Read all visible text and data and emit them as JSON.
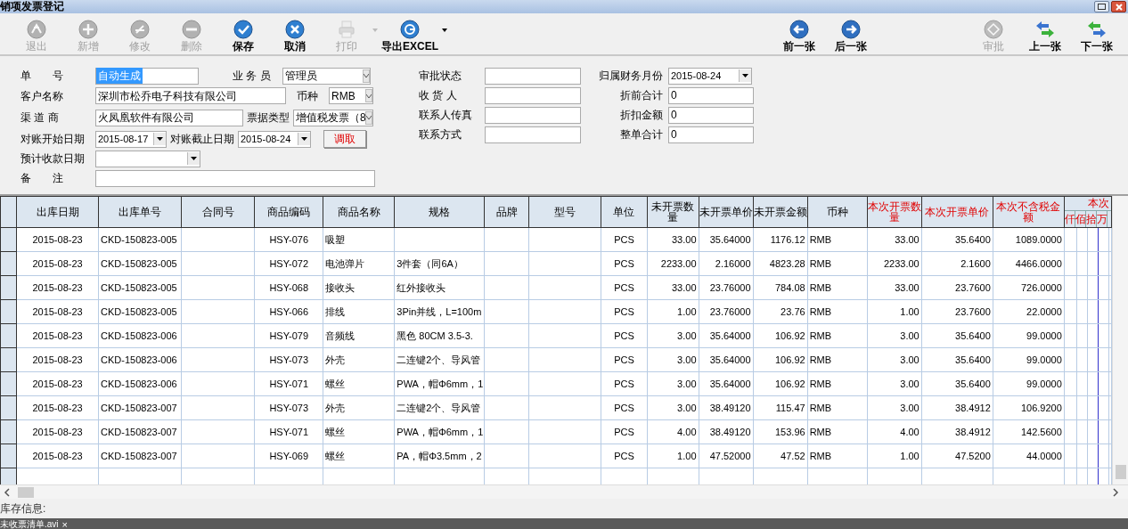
{
  "window": {
    "title": "销项发票登记"
  },
  "toolbar_left": [
    {
      "label": "退出",
      "disabled": true
    },
    {
      "label": "新增",
      "disabled": true
    },
    {
      "label": "修改",
      "disabled": true
    },
    {
      "label": "删除",
      "disabled": true
    },
    {
      "label": "保存",
      "disabled": false
    },
    {
      "label": "取消",
      "disabled": false
    },
    {
      "label": "打印",
      "disabled": true
    },
    {
      "label": "导出EXCEL",
      "disabled": false
    }
  ],
  "toolbar_right": [
    {
      "label": "前一张",
      "disabled": false
    },
    {
      "label": "后一张",
      "disabled": false
    },
    {
      "label": "审批",
      "disabled": true
    },
    {
      "label": "上一张",
      "disabled": false
    },
    {
      "label": "下一张",
      "disabled": false
    }
  ],
  "form_left": [
    [
      {
        "label": "单　　号",
        "kind": "text",
        "value": "自动生成",
        "selected": true
      },
      {
        "label": "业 务 员",
        "kind": "select",
        "value": "管理员"
      }
    ],
    [
      {
        "label": "客户名称",
        "kind": "text",
        "value": "深圳市松乔电子科技有限公司"
      },
      {
        "label": "币种",
        "kind": "select",
        "value": "RMB"
      }
    ],
    [
      {
        "label": "渠 道 商",
        "kind": "text",
        "value": "火凤凰软件有限公司"
      },
      {
        "label": "票据类型",
        "kind": "select",
        "value": "增值税发票（8"
      }
    ],
    [
      {
        "label": "对账开始日期",
        "kind": "date",
        "value": "2015-08-17"
      },
      {
        "label": "对账截止日期",
        "kind": "date",
        "value": "2015-08-24"
      },
      {
        "kind": "button",
        "label": "调取"
      }
    ],
    [
      {
        "label": "预计收款日期",
        "kind": "date"
      }
    ],
    [
      {
        "label": "备　　注",
        "kind": "text"
      }
    ]
  ],
  "form_middle": [
    {
      "label": "审批状态"
    },
    {
      "label": "收 货 人"
    },
    {
      "label": "联系人传真"
    },
    {
      "label": "联系方式"
    }
  ],
  "form_right": [
    {
      "label": "归属财务月份",
      "kind": "date",
      "value": "2015-08-24"
    },
    {
      "label": "折前合计",
      "kind": "text",
      "value": "0"
    },
    {
      "label": "折扣金额",
      "kind": "text",
      "value": "0"
    },
    {
      "label": "整单合计",
      "kind": "text",
      "value": "0"
    }
  ],
  "table": {
    "columns": [
      {
        "label": "出库日期",
        "highlight": false
      },
      {
        "label": "出库单号",
        "highlight": false
      },
      {
        "label": "合同号",
        "highlight": false
      },
      {
        "label": "商品编码",
        "highlight": false
      },
      {
        "label": "商品名称",
        "highlight": false
      },
      {
        "label": "规格",
        "highlight": false
      },
      {
        "label": "品牌",
        "highlight": false
      },
      {
        "label": "型号",
        "highlight": false
      },
      {
        "label": "单位",
        "highlight": false
      },
      {
        "label": "未开票数量",
        "highlight": false
      },
      {
        "label": "未开票单价",
        "highlight": false
      },
      {
        "label": "未开票金额",
        "highlight": false
      },
      {
        "label": "币种",
        "highlight": false
      },
      {
        "label": "本次开票数量",
        "highlight": true
      },
      {
        "label": "本次开票单价",
        "highlight": true
      },
      {
        "label": "本次不含税金额",
        "highlight": true
      },
      {
        "label": "本次",
        "highlight": true,
        "subcolumns": [
          "仟",
          "佰",
          "拾",
          "万"
        ]
      }
    ],
    "rows": [
      {
        "date": "2015-08-23",
        "number": "CKD-150823-005",
        "code": "HSY-076",
        "name": "吸塑",
        "unit": "PCS",
        "qty": "33.00",
        "price": "35.64000",
        "amount": "1176.12",
        "currency": "RMB",
        "inv_qty": "33.00",
        "inv_price": "35.6400",
        "net": "1089.0000"
      },
      {
        "date": "2015-08-23",
        "number": "CKD-150823-005",
        "code": "HSY-072",
        "name": "电池弹片",
        "spec": "3件套（同6A）",
        "unit": "PCS",
        "qty": "2233.00",
        "price": "2.16000",
        "amount": "4823.28",
        "currency": "RMB",
        "inv_qty": "2233.00",
        "inv_price": "2.1600",
        "net": "4466.0000"
      },
      {
        "date": "2015-08-23",
        "number": "CKD-150823-005",
        "code": "HSY-068",
        "name": "接收头",
        "spec": "红外接收头",
        "unit": "PCS",
        "qty": "33.00",
        "price": "23.76000",
        "amount": "784.08",
        "currency": "RMB",
        "inv_qty": "33.00",
        "inv_price": "23.7600",
        "net": "726.0000"
      },
      {
        "date": "2015-08-23",
        "number": "CKD-150823-005",
        "code": "HSY-066",
        "name": "排线",
        "spec": "3Pin并线，L=100m",
        "unit": "PCS",
        "qty": "1.00",
        "price": "23.76000",
        "amount": "23.76",
        "currency": "RMB",
        "inv_qty": "1.00",
        "inv_price": "23.7600",
        "net": "22.0000"
      },
      {
        "date": "2015-08-23",
        "number": "CKD-150823-006",
        "code": "HSY-079",
        "name": "音频线",
        "spec": "黑色 80CM 3.5-3.",
        "unit": "PCS",
        "qty": "3.00",
        "price": "35.64000",
        "amount": "106.92",
        "currency": "RMB",
        "inv_qty": "3.00",
        "inv_price": "35.6400",
        "net": "99.0000"
      },
      {
        "date": "2015-08-23",
        "number": "CKD-150823-006",
        "code": "HSY-073",
        "name": "外壳",
        "spec": "二连键2个、导风管",
        "unit": "PCS",
        "qty": "3.00",
        "price": "35.64000",
        "amount": "106.92",
        "currency": "RMB",
        "inv_qty": "3.00",
        "inv_price": "35.6400",
        "net": "99.0000"
      },
      {
        "date": "2015-08-23",
        "number": "CKD-150823-006",
        "code": "HSY-071",
        "name": "螺丝",
        "spec": "PWA，帽Φ6mm，1",
        "unit": "PCS",
        "qty": "3.00",
        "price": "35.64000",
        "amount": "106.92",
        "currency": "RMB",
        "inv_qty": "3.00",
        "inv_price": "35.6400",
        "net": "99.0000"
      },
      {
        "date": "2015-08-23",
        "number": "CKD-150823-007",
        "code": "HSY-073",
        "name": "外壳",
        "spec": "二连键2个、导风管",
        "unit": "PCS",
        "qty": "3.00",
        "price": "38.49120",
        "amount": "115.47",
        "currency": "RMB",
        "inv_qty": "3.00",
        "inv_price": "38.4912",
        "net": "106.9200"
      },
      {
        "date": "2015-08-23",
        "number": "CKD-150823-007",
        "code": "HSY-071",
        "name": "螺丝",
        "spec": "PWA，帽Φ6mm，1",
        "unit": "PCS",
        "qty": "4.00",
        "price": "38.49120",
        "amount": "153.96",
        "currency": "RMB",
        "inv_qty": "4.00",
        "inv_price": "38.4912",
        "net": "142.5600"
      },
      {
        "date": "2015-08-23",
        "number": "CKD-150823-007",
        "code": "HSY-069",
        "name": "螺丝",
        "spec": "PA，帽Φ3.5mm，2",
        "unit": "PCS",
        "qty": "1.00",
        "price": "47.52000",
        "amount": "47.52",
        "currency": "RMB",
        "inv_qty": "1.00",
        "inv_price": "47.5200",
        "net": "44.0000"
      }
    ]
  },
  "status_bar": {
    "label": "库存信息:"
  },
  "taskbar": {
    "file": "未收票清单.avi",
    "close": "×"
  }
}
